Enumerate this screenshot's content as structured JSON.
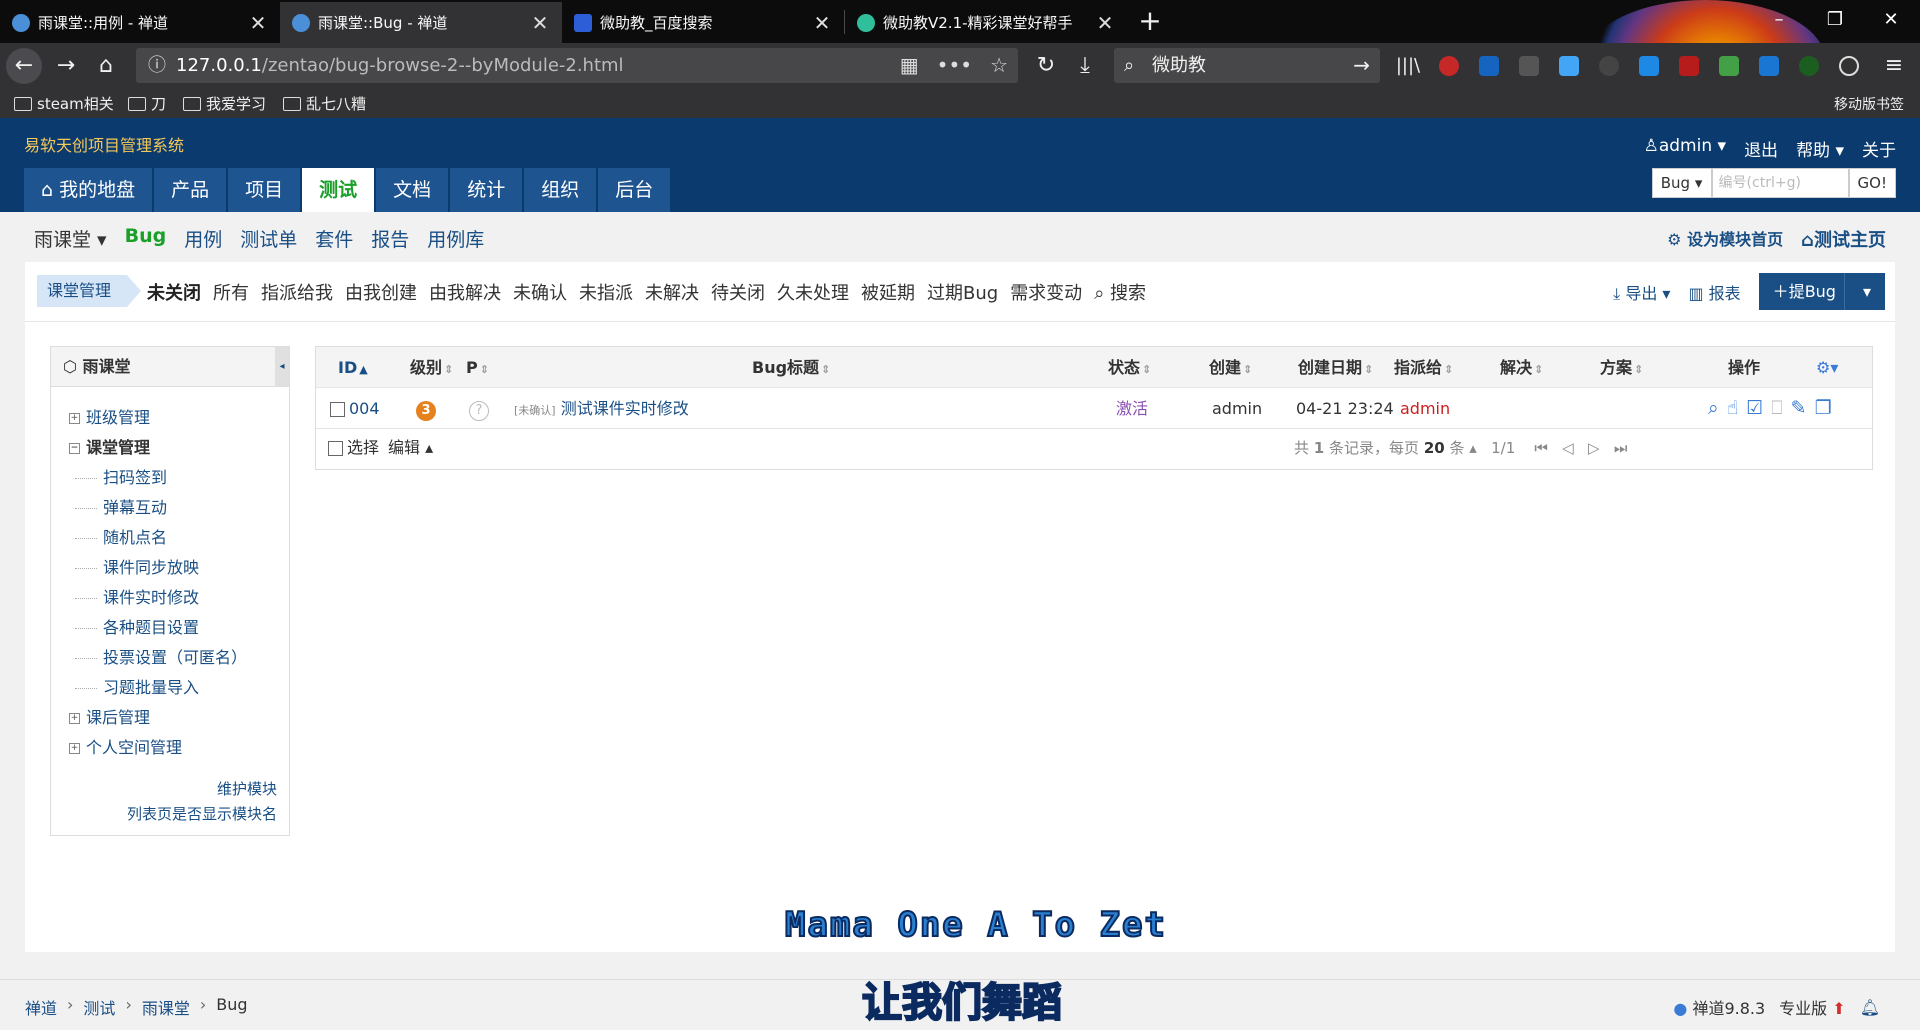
{
  "browser": {
    "tabs": [
      {
        "title": "雨课堂::用例 - 禅道",
        "active": false
      },
      {
        "title": "雨课堂::Bug - 禅道",
        "active": true
      },
      {
        "title": "微助教_百度搜索",
        "active": false
      },
      {
        "title": "微助教V2.1-精彩课堂好帮手",
        "active": false
      }
    ],
    "url_host": "127.0.0.1",
    "url_path": "/zentao/bug-browse-2--byModule-2.html",
    "search_value": "微助教",
    "bookmarks": [
      "steam相关",
      "刀",
      "我爱学习",
      "乱七八糟"
    ],
    "mobile_bookmarks": "移动版书签"
  },
  "app": {
    "name": "易软天创项目管理系统",
    "main_nav": [
      "我的地盘",
      "产品",
      "项目",
      "测试",
      "文档",
      "统计",
      "组织",
      "后台"
    ],
    "active_nav": "测试",
    "user": "admin",
    "logout": "退出",
    "help": "帮助",
    "about": "关于",
    "search_type": "Bug",
    "search_placeholder": "编号(ctrl+g)",
    "search_go": "GO!"
  },
  "subnav": {
    "product": "雨课堂",
    "items": [
      "Bug",
      "用例",
      "测试单",
      "套件",
      "报告",
      "用例库"
    ],
    "set_home": "设为模块首页",
    "test_home": "测试主页"
  },
  "featurebar": {
    "module": "课堂管理",
    "filters": [
      "未关闭",
      "所有",
      "指派给我",
      "由我创建",
      "由我解决",
      "未确认",
      "未指派",
      "未解决",
      "待关闭",
      "久未处理",
      "被延期",
      "过期Bug",
      "需求变动"
    ],
    "search": "搜索",
    "export": "导出",
    "report": "报表",
    "create_bug": "提Bug"
  },
  "sidebar": {
    "title": "雨课堂",
    "tree": [
      {
        "label": "班级管理",
        "expanded": false,
        "children": []
      },
      {
        "label": "课堂管理",
        "expanded": true,
        "children": [
          "扫码签到",
          "弹幕互动",
          "随机点名",
          "课件同步放映",
          "课件实时修改",
          "各种题目设置",
          "投票设置（可匿名）",
          "习题批量导入"
        ]
      },
      {
        "label": "课后管理",
        "expanded": false,
        "children": []
      },
      {
        "label": "个人空间管理",
        "expanded": false,
        "children": []
      }
    ],
    "links": [
      "维护模块",
      "列表页是否显示模块名"
    ]
  },
  "table": {
    "headers": {
      "id": "ID",
      "severity": "级别",
      "pri": "P",
      "title": "Bug标题",
      "status": "状态",
      "creator": "创建",
      "created": "创建日期",
      "assigned": "指派给",
      "resolved": "解决",
      "resolution": "方案",
      "actions": "操作"
    },
    "rows": [
      {
        "id": "004",
        "severity": "3",
        "pri": "?",
        "tag": "[未确认]",
        "title": "测试课件实时修改",
        "status": "激活",
        "creator": "admin",
        "created": "04-21 23:24",
        "assigned": "admin",
        "resolved": "",
        "resolution": ""
      }
    ],
    "footer": {
      "select": "选择",
      "edit": "编辑",
      "summary_pre": "共",
      "total": "1",
      "summary_mid": "条记录，每页",
      "per_page": "20",
      "summary_post": "条",
      "pages": "1/1"
    }
  },
  "watermark": {
    "line1": "Mama One A To Zet",
    "line2": "让我们舞蹈"
  },
  "statusbar": {
    "crumbs": [
      "禅道",
      "测试",
      "雨课堂",
      "Bug"
    ],
    "version": "禅道9.8.3",
    "edition": "专业版"
  },
  "colors": {
    "header": "#0b3a6e",
    "link": "#1a4f85",
    "active_green": "#1a9f29",
    "status_active": "#8a4fb3",
    "assigned_red": "#cc2020"
  }
}
